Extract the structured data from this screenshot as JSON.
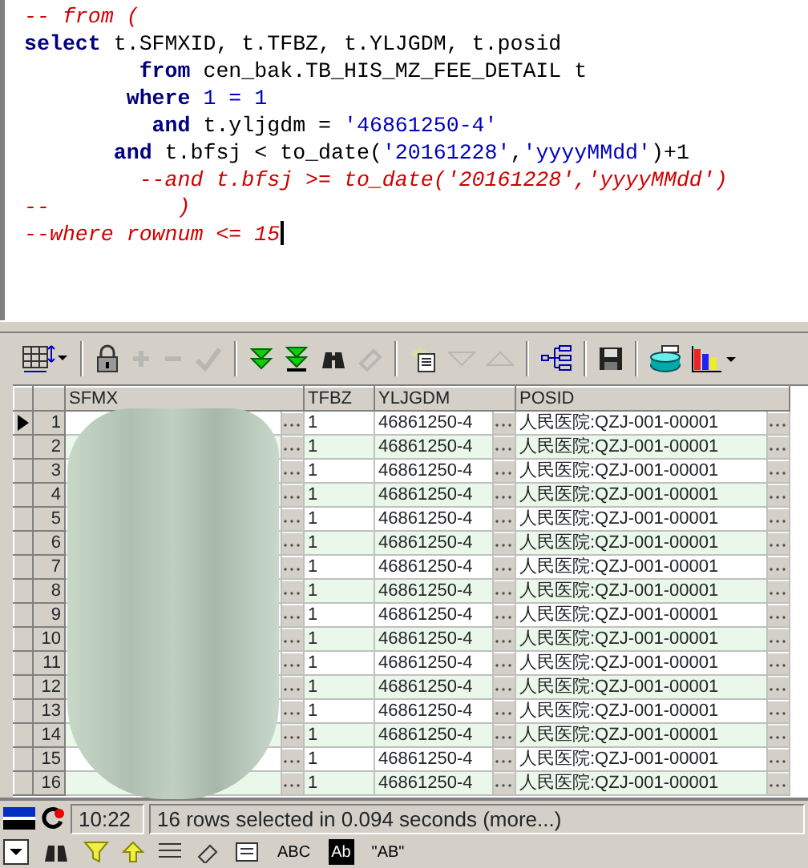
{
  "editor": {
    "lines": [
      [
        {
          "kind": "comment",
          "text": "-- from ("
        }
      ],
      [
        {
          "kind": "keyword",
          "text": "select"
        },
        {
          "kind": "plain",
          "text": " t.SFMXID, t.TFBZ, t.YLJGDM, t.posid"
        }
      ],
      [
        {
          "kind": "keyword",
          "text": "         from"
        },
        {
          "kind": "plain",
          "text": " cen_bak.TB_HIS_MZ_FEE_DETAIL t"
        }
      ],
      [
        {
          "kind": "keyword",
          "text": "        where"
        },
        {
          "kind": "literal",
          "text": " 1 = 1"
        }
      ],
      [
        {
          "kind": "keyword",
          "text": "          and"
        },
        {
          "kind": "plain",
          "text": " t.yljgdm = "
        },
        {
          "kind": "literal",
          "text": "'46861250-4'"
        }
      ],
      [
        {
          "kind": "keyword",
          "text": "       and"
        },
        {
          "kind": "plain",
          "text": " t.bfsj < to_date("
        },
        {
          "kind": "literal",
          "text": "'20161228'"
        },
        {
          "kind": "plain",
          "text": ","
        },
        {
          "kind": "literal",
          "text": "'yyyyMMdd'"
        },
        {
          "kind": "plain",
          "text": ")+1"
        }
      ],
      [
        {
          "kind": "comment",
          "text": "         --and t.bfsj >= to_date('20161228','yyyyMMdd')"
        }
      ],
      [
        {
          "kind": "comment",
          "text": "--          )"
        }
      ],
      [
        {
          "kind": "comment",
          "text": "--where rownum <= 15"
        }
      ]
    ]
  },
  "toolbar": {
    "groups": [
      [
        {
          "disabled": false
        }
      ],
      [
        {
          "disabled": false
        },
        {
          "disabled": true
        },
        {
          "disabled": true
        },
        {
          "disabled": true
        }
      ],
      [
        {
          "disabled": false
        },
        {
          "disabled": false
        },
        {
          "disabled": false
        },
        {
          "disabled": true
        }
      ],
      [
        {
          "disabled": false
        },
        {
          "disabled": true
        },
        {
          "disabled": true
        }
      ],
      [
        {
          "disabled": false
        }
      ],
      [
        {
          "disabled": false
        }
      ],
      [
        {
          "disabled": false
        },
        {
          "disabled": false
        }
      ]
    ]
  },
  "grid": {
    "columns": [
      "SFMX",
      "TFBZ",
      "YLJGDM",
      "POSID"
    ],
    "rows": [
      {
        "num": "1",
        "current": true,
        "tfbz": "1",
        "yljgdm": "46861250-4",
        "posid": "人民医院:QZJ-001-00001"
      },
      {
        "num": "2",
        "current": false,
        "tfbz": "1",
        "yljgdm": "46861250-4",
        "posid": "人民医院:QZJ-001-00001"
      },
      {
        "num": "3",
        "current": false,
        "tfbz": "1",
        "yljgdm": "46861250-4",
        "posid": "人民医院:QZJ-001-00001"
      },
      {
        "num": "4",
        "current": false,
        "tfbz": "1",
        "yljgdm": "46861250-4",
        "posid": "人民医院:QZJ-001-00001"
      },
      {
        "num": "5",
        "current": false,
        "tfbz": "1",
        "yljgdm": "46861250-4",
        "posid": "人民医院:QZJ-001-00001"
      },
      {
        "num": "6",
        "current": false,
        "tfbz": "1",
        "yljgdm": "46861250-4",
        "posid": "人民医院:QZJ-001-00001"
      },
      {
        "num": "7",
        "current": false,
        "tfbz": "1",
        "yljgdm": "46861250-4",
        "posid": "人民医院:QZJ-001-00001"
      },
      {
        "num": "8",
        "current": false,
        "tfbz": "1",
        "yljgdm": "46861250-4",
        "posid": "人民医院:QZJ-001-00001"
      },
      {
        "num": "9",
        "current": false,
        "tfbz": "1",
        "yljgdm": "46861250-4",
        "posid": "人民医院:QZJ-001-00001"
      },
      {
        "num": "10",
        "current": false,
        "tfbz": "1",
        "yljgdm": "46861250-4",
        "posid": "人民医院:QZJ-001-00001"
      },
      {
        "num": "11",
        "current": false,
        "tfbz": "1",
        "yljgdm": "46861250-4",
        "posid": "人民医院:QZJ-001-00001"
      },
      {
        "num": "12",
        "current": false,
        "tfbz": "1",
        "yljgdm": "46861250-4",
        "posid": "人民医院:QZJ-001-00001"
      },
      {
        "num": "13",
        "current": false,
        "tfbz": "1",
        "yljgdm": "46861250-4",
        "posid": "人民医院:QZJ-001-00001"
      },
      {
        "num": "14",
        "current": false,
        "tfbz": "1",
        "yljgdm": "46861250-4",
        "posid": "人民医院:QZJ-001-00001"
      },
      {
        "num": "15",
        "current": false,
        "tfbz": "1",
        "yljgdm": "46861250-4",
        "posid": "人民医院:QZJ-001-00001"
      },
      {
        "num": "16",
        "current": false,
        "tfbz": "1",
        "yljgdm": "46861250-4",
        "posid": "人民医院:QZJ-001-00001"
      }
    ]
  },
  "status_bar": {
    "time": "10:22",
    "message": "16 rows selected in 0.094 seconds (more...)"
  },
  "bottom_toolbar": {
    "labels": [
      "ABC",
      "Ab",
      "\"AB\""
    ]
  }
}
